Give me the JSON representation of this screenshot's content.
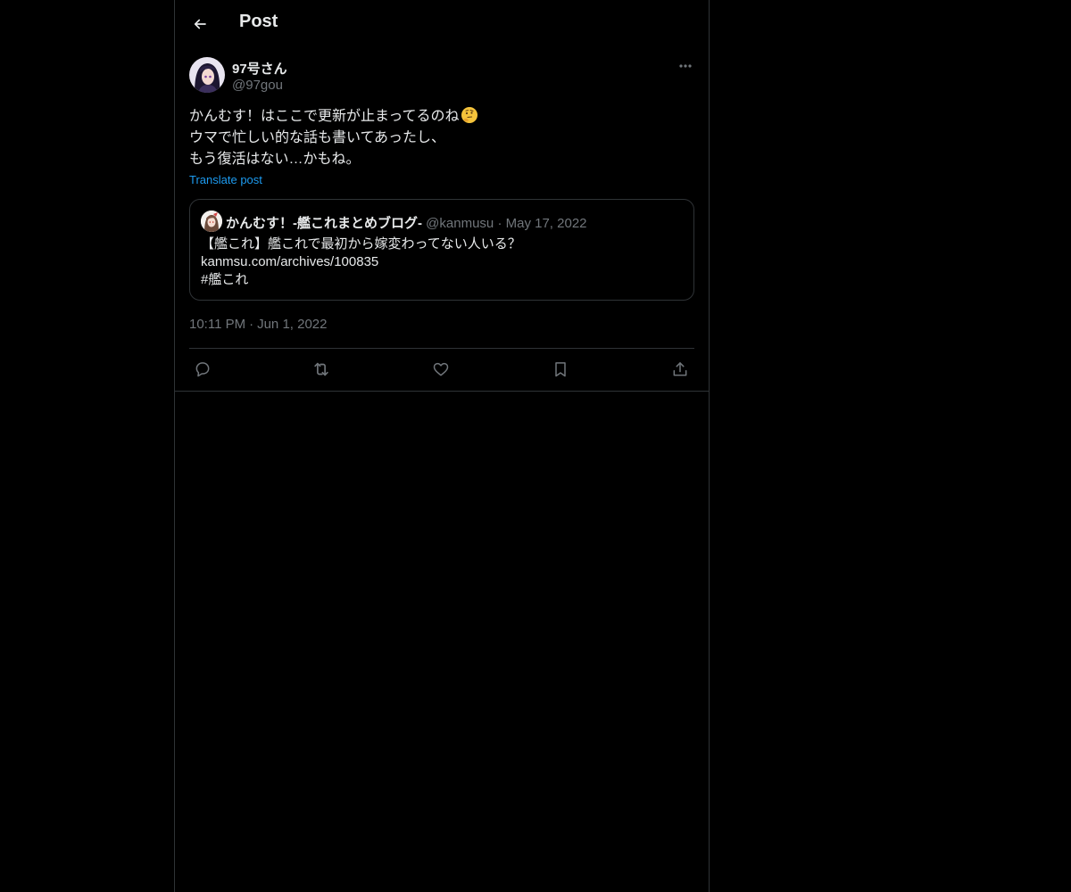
{
  "header": {
    "title": "Post"
  },
  "author": {
    "name": "97号さん",
    "handle": "@97gou"
  },
  "post": {
    "lines": [
      "かんむす！はここで更新が止まってるのね",
      "ウマで忙しい的な話も書いてあったし、",
      "もう復活はない…かもね。"
    ],
    "emoji": "thinking-face",
    "translate_label": "Translate post",
    "time": "10:11 PM",
    "date": "Jun 1, 2022",
    "separator": "·"
  },
  "quote": {
    "name": "かんむす！-艦これまとめブログ-",
    "handle": "@kanmusu",
    "separator": "·",
    "date": "May 17, 2022",
    "lines": [
      "【艦これ】艦これで最初から嫁変わってない人いる？",
      "kanmsu.com/archives/100835",
      "#艦これ"
    ]
  },
  "actions": {
    "icons": [
      "reply-icon",
      "repost-icon",
      "like-icon",
      "bookmark-icon",
      "share-icon"
    ]
  },
  "colors": {
    "background": "#000000",
    "text": "#e7e9ea",
    "muted": "#71767b",
    "border": "#2f3336",
    "link": "#1d9bf0"
  }
}
